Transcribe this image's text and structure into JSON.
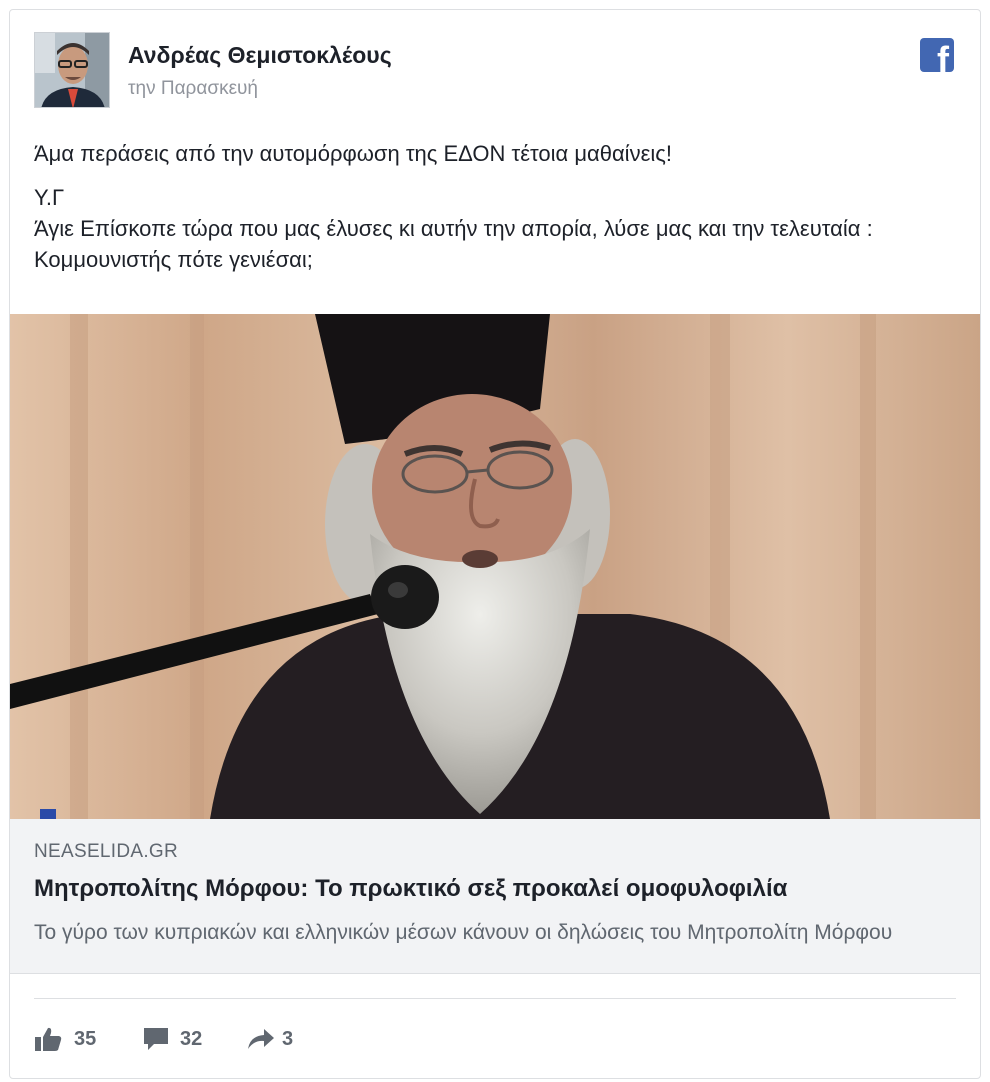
{
  "post": {
    "author": "Ανδρέας Θεμιστοκλέους",
    "timestamp": "την Παρασκευή",
    "platform_icon": "facebook-logo-icon",
    "brand_color": "#4267b2",
    "text": {
      "line1": "Άμα περάσεις από την αυτομόρφωση της ΕΔΟΝ τέτοια μαθαίνεις!",
      "line2": "Υ.Γ",
      "line3": "Άγιε Επίσκοπε τώρα που μας έλυσες κι αυτήν την απορία, λύσε μας και την τελευταία : Κομμουνιστής πότε γενιέσαι;"
    }
  },
  "link": {
    "domain": "NEASELIDA.GR",
    "title": "Μητροπολίτης Μόρφου: Το πρωκτικό σεξ προκαλεί ομοφυλοφιλία",
    "description": "Το γύρο των κυπριακών και ελληνικών μέσων κάνουν οι δηλώσεις του Μητροπολίτη Μόρφου"
  },
  "actions": {
    "likes": "35",
    "comments": "32",
    "shares": "3"
  }
}
